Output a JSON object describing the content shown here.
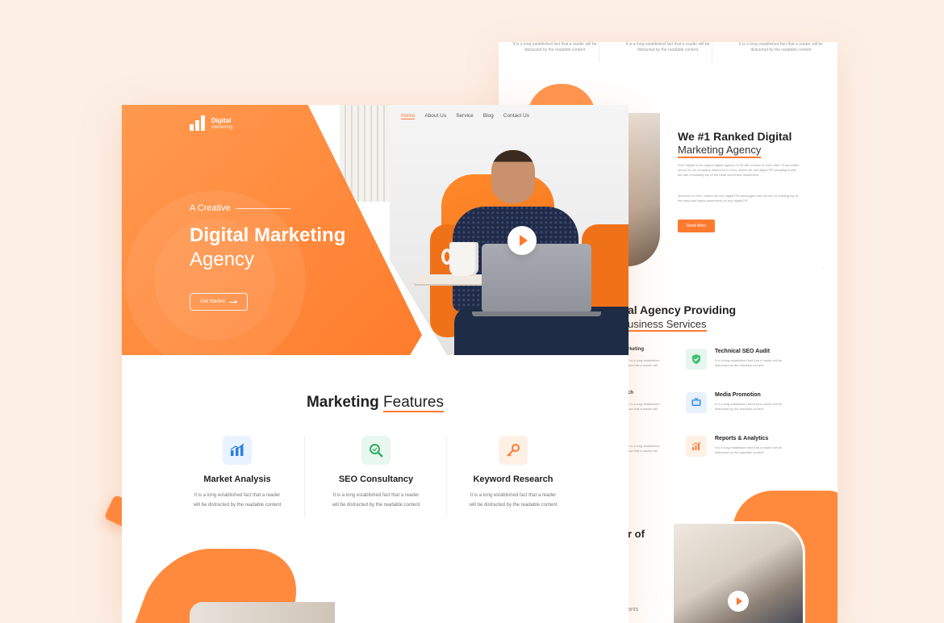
{
  "brand": {
    "name": "Digital",
    "tagline": "Marketing",
    "accent": "#ff7a2f"
  },
  "nav": {
    "items": [
      "Home",
      "About Us",
      "Service",
      "Blog",
      "Contact Us"
    ],
    "active": "Home"
  },
  "hero": {
    "eyebrow": "A Creative",
    "title": "Digital Marketing",
    "title2": "Agency",
    "button": "Get Started",
    "play_icon": "play-icon"
  },
  "features": {
    "title_prefix": "Marketing",
    "title_highlight": "Features",
    "items": [
      {
        "name": "Market Analysis",
        "text": "It is a long established fact that a reader will be distracted by the readable content",
        "icon": "bar-chart-icon",
        "color": "#e8f3ff"
      },
      {
        "name": "SEO Consultancy",
        "text": "It is a long established fact that a reader will be distracted by the readable content",
        "icon": "magnifier-icon",
        "color": "#e9f8ef"
      },
      {
        "name": "Keyword Research",
        "text": "It is a long established fact that a reader will be distracted by the readable content",
        "icon": "key-icon",
        "color": "#fff0e6"
      }
    ]
  },
  "back_page": {
    "top_cols": [
      "It is a long established fact that a reader will be distracted by the readable content",
      "It is a long established fact that a reader will be distracted by the readable content",
      "It is a long established fact that a reader will be distracted by the readable content"
    ],
    "ranked_title": "We #1 Ranked Digital",
    "ranked_title2": "Marketing Agency",
    "ranked_para1": "Over Digital is the largest digital agency of UK with a team of more than 70 specialist serves to our company. Welcome to Over, where we use digital PR campaigns with the aim of building top of the head and brand awareness.",
    "ranked_para2": "Welcome to Over, where we use digital PR campaigns with the aim of building top of the head and brand awareness for any digital PR.",
    "read_more": "Read More",
    "providing_title": "al Agency Providing",
    "providing_sub": "usiness Services",
    "left_services": [
      {
        "title": "rketing",
        "text": "It is a long established fact that a reader will"
      },
      {
        "title": "ch",
        "text": "It is a long established fact that a reader will"
      },
      {
        "title": "",
        "text": "It is a long established fact that a reader will"
      }
    ],
    "services": [
      {
        "title": "Technical SEO Audit",
        "text": "It is a long established fact that a reader will be distracted by the readable content",
        "icon": "shield-check-icon",
        "color": "#e6f6ec"
      },
      {
        "title": "Media Promotion",
        "text": "It is a long established fact that a reader will be distracted by the readable content",
        "icon": "tv-icon",
        "color": "#e6f1fb"
      },
      {
        "title": "Reports & Analytics",
        "text": "It is a long established fact that a reader will be distracted by the readable content",
        "icon": "analytics-icon",
        "color": "#fff0e6"
      }
    ],
    "of_text": "r of",
    "bottom_text": "ants"
  }
}
